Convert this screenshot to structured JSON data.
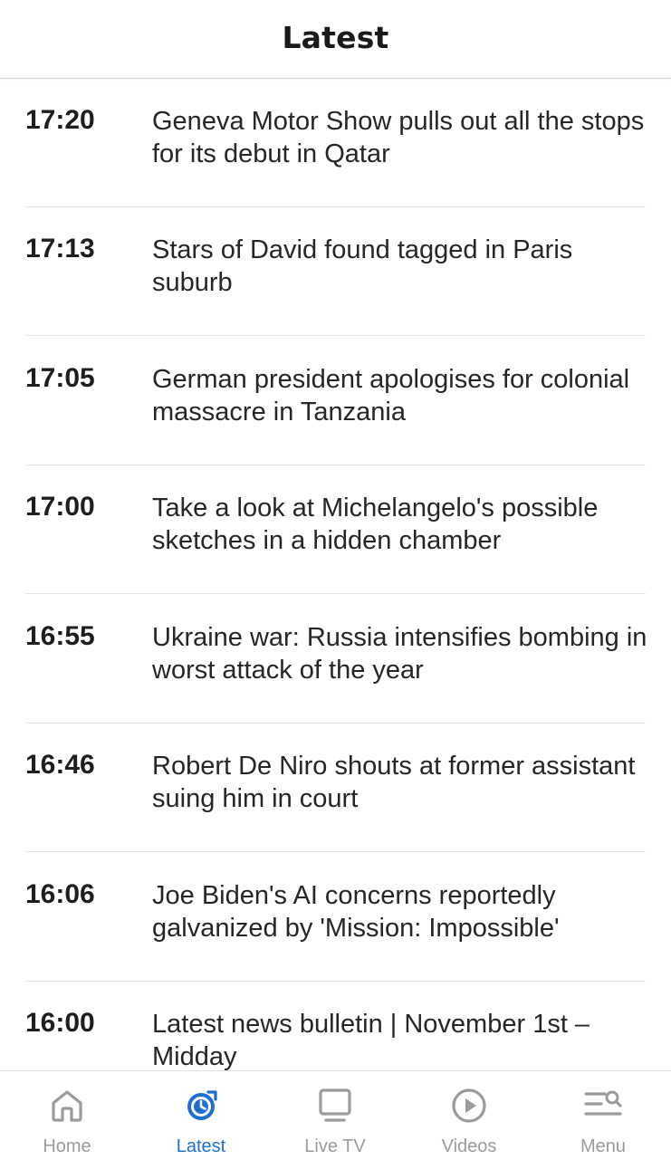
{
  "header": {
    "title": "Latest"
  },
  "feed": [
    {
      "time": "17:20",
      "headline": "Geneva Motor Show pulls out all the stops for its debut in Qatar"
    },
    {
      "time": "17:13",
      "headline": "Stars of David found tagged in Paris suburb"
    },
    {
      "time": "17:05",
      "headline": "German president apologises for colonial massacre in Tanzania"
    },
    {
      "time": "17:00",
      "headline": "Take a look at Michelangelo's possible sketches in a hidden chamber"
    },
    {
      "time": "16:55",
      "headline": "Ukraine war: Russia intensifies bombing in worst attack of the year"
    },
    {
      "time": "16:46",
      "headline": "Robert De Niro shouts at former assistant suing him in court"
    },
    {
      "time": "16:06",
      "headline": "Joe Biden's AI concerns reportedly galvanized by 'Mission: Impossible'"
    },
    {
      "time": "16:00",
      "headline": "Latest news bulletin | November 1st – Midday"
    }
  ],
  "tabbar": {
    "active": "Latest",
    "accent": "#1e6fd1",
    "inactive_color": "#9b9b9b",
    "tabs": [
      {
        "label": "Home",
        "icon": "home-icon"
      },
      {
        "label": "Latest",
        "icon": "latest-clock-icon"
      },
      {
        "label": "Live TV",
        "icon": "tv-icon"
      },
      {
        "label": "Videos",
        "icon": "play-circle-icon"
      },
      {
        "label": "Menu",
        "icon": "menu-search-icon"
      }
    ]
  }
}
